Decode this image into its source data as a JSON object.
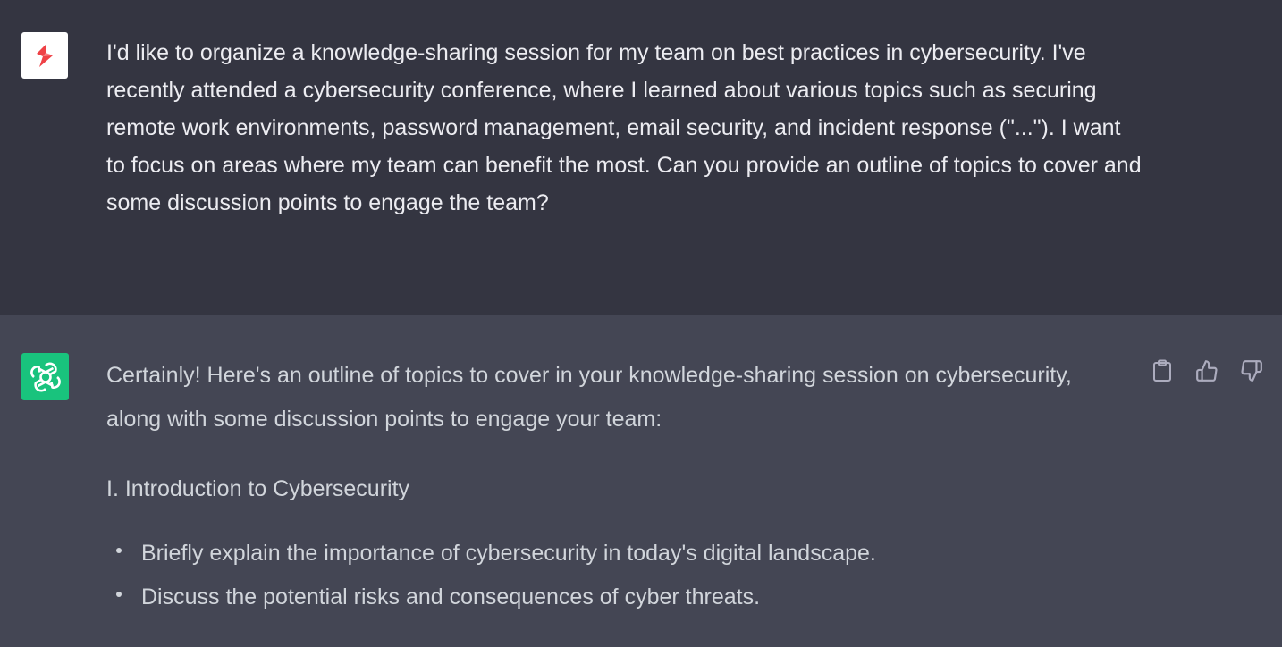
{
  "user_message": {
    "text": "I'd like to organize a knowledge-sharing session for my team on best practices in cybersecurity. I've recently attended a cybersecurity conference, where I learned about various topics such as securing remote work environments, password management, email security, and incident response (\"...\"). I want to focus on areas where my team can benefit the most. Can you provide an outline of topics to cover and some discussion points to engage the team?"
  },
  "assistant_message": {
    "intro": "Certainly! Here's an outline of topics to cover in your knowledge-sharing session on cybersecurity, along with some discussion points to engage your team:",
    "section_heading": "I. Introduction to Cybersecurity",
    "bullets": [
      "Briefly explain the importance of cybersecurity in today's digital landscape.",
      "Discuss the potential risks and consequences of cyber threats."
    ]
  },
  "actions": {
    "copy_icon": "clipboard-icon",
    "thumbs_up_icon": "thumbs-up-icon",
    "thumbs_down_icon": "thumbs-down-icon"
  },
  "colors": {
    "user_bg": "#343541",
    "assistant_bg": "#444654",
    "bot_avatar": "#19c37d",
    "user_avatar_mark": "#ef4146"
  }
}
